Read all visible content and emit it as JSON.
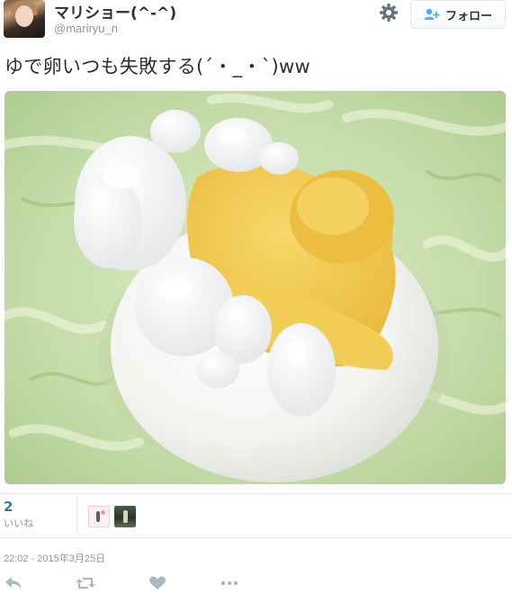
{
  "header": {
    "display_name": "マリショー(^-^)",
    "screen_name": "@mariryu_n",
    "follow_label": "フォロー",
    "settings_icon": "gear-icon",
    "follow_icon": "person-add-icon"
  },
  "tweet": {
    "text": "ゆで卵いつも失敗する(´・_・`)ww"
  },
  "stats": {
    "likes_count": "2",
    "likes_label": "いいね"
  },
  "footer": {
    "timestamp": "22:02 - 2015年3月25日"
  },
  "actions": [
    "reply-icon",
    "retweet-icon",
    "like-icon",
    "more-icon"
  ],
  "colors": {
    "link_blue": "#2b7bb9",
    "meta_gray": "#8899a6",
    "text": "#292f33",
    "border": "#e1e8ed"
  }
}
